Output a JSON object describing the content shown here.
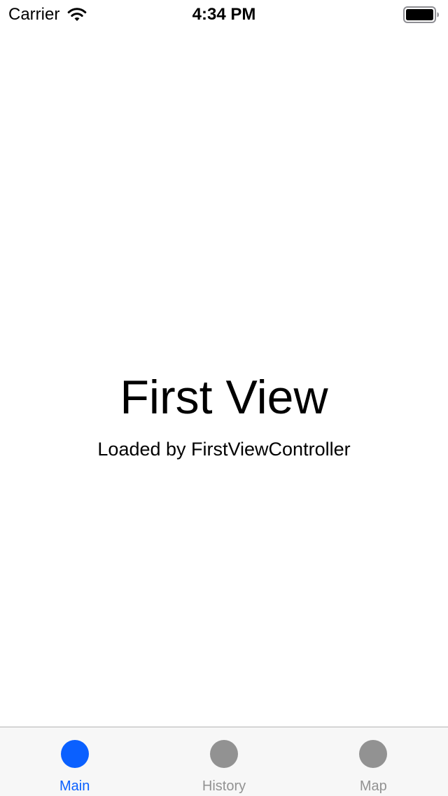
{
  "status_bar": {
    "carrier": "Carrier",
    "time": "4:34 PM",
    "wifi_icon": "wifi-icon",
    "battery_icon": "battery-icon"
  },
  "main": {
    "title": "First View",
    "subtitle": "Loaded by FirstViewController"
  },
  "tab_bar": {
    "active_color": "#0a60ff",
    "inactive_color": "#929292",
    "tabs": [
      {
        "label": "Main",
        "icon": "circle-icon",
        "selected": true
      },
      {
        "label": "History",
        "icon": "circle-icon",
        "selected": false
      },
      {
        "label": "Map",
        "icon": "circle-icon",
        "selected": false
      }
    ]
  }
}
